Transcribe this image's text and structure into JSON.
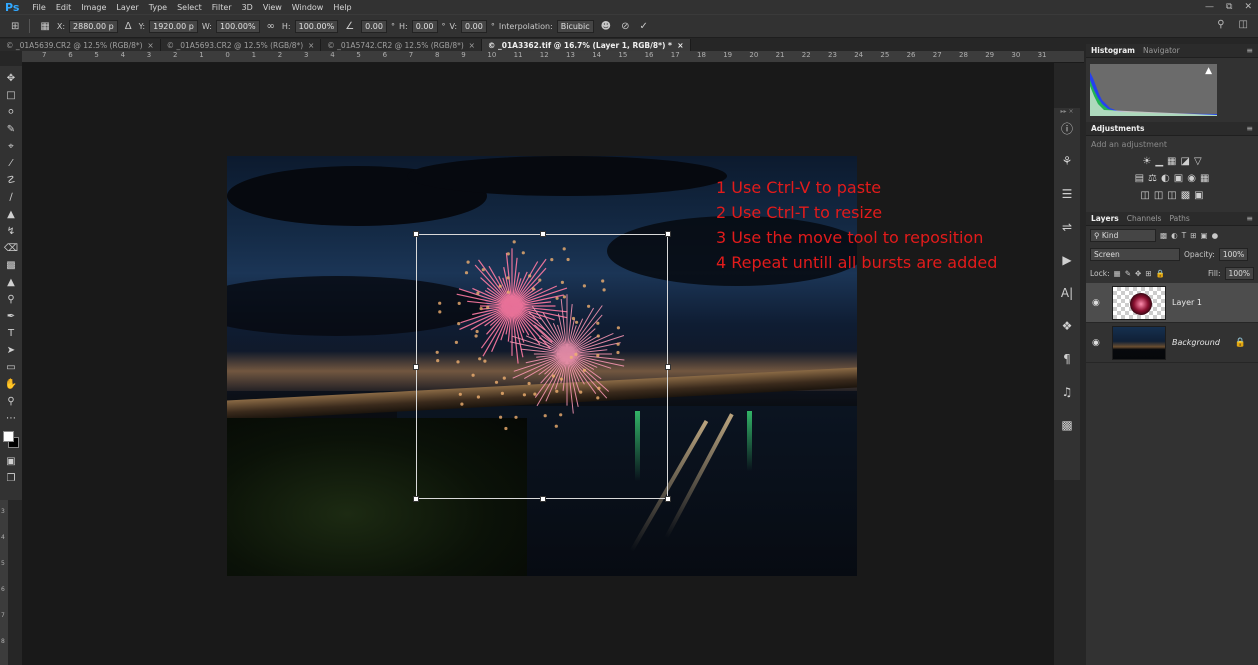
{
  "menubar": {
    "logo": "Ps",
    "items": [
      "File",
      "Edit",
      "Image",
      "Layer",
      "Type",
      "Select",
      "Filter",
      "3D",
      "View",
      "Window",
      "Help"
    ]
  },
  "options": {
    "x_label": "X:",
    "x_value": "2880.00 p",
    "y_label": "Y:",
    "y_value": "1920.00 p",
    "w_label": "W:",
    "w_value": "100.00%",
    "h_label": "H:",
    "h_value": "100.00%",
    "angle_value": "0.00",
    "hskew_label": "H:",
    "hskew_value": "0.00",
    "vskew_label": "V:",
    "vskew_value": "0.00",
    "interp_label": "Interpolation:",
    "interp_value": "Bicubic"
  },
  "tabs": [
    {
      "label": "_01A5639.CR2 @ 12.5% (RGB/8*)",
      "active": false
    },
    {
      "label": "_01A5693.CR2 @ 12.5% (RGB/8*)",
      "active": false
    },
    {
      "label": "_01A5742.CR2 @ 12.5% (RGB/8*)",
      "active": false
    },
    {
      "label": "_01A3362.tif @ 16.7% (Layer 1, RGB/8*) *",
      "active": true
    }
  ],
  "ruler": {
    "h_ticks": [
      "7",
      "6",
      "5",
      "4",
      "3",
      "2",
      "1",
      "0",
      "1",
      "2",
      "3",
      "4",
      "5",
      "6",
      "7",
      "8",
      "9",
      "10",
      "11",
      "12",
      "13",
      "14",
      "15",
      "16",
      "17",
      "18",
      "19",
      "20",
      "21",
      "22",
      "23",
      "24",
      "25",
      "26",
      "27",
      "28",
      "29",
      "30",
      "31"
    ],
    "v_ticks": [
      "3",
      "4",
      "5",
      "6",
      "7",
      "8"
    ]
  },
  "instructions": [
    "1 Use Ctrl-V to paste",
    "2 Use Ctrl-T to resize",
    "3 Use the move tool to reposition",
    "4 Repeat untill all bursts are added"
  ],
  "panels": {
    "histogram_tab": "Histogram",
    "navigator_tab": "Navigator",
    "adjustments_title": "Adjustments",
    "adjustments_hint": "Add an adjustment",
    "layers_tab": "Layers",
    "channels_tab": "Channels",
    "paths_tab": "Paths",
    "kind_label": "Kind",
    "blend_mode": "Screen",
    "opacity_label": "Opacity:",
    "opacity_value": "100%",
    "lock_label": "Lock:",
    "fill_label": "Fill:",
    "fill_value": "100%",
    "layers": [
      {
        "name": "Layer 1",
        "selected": true
      },
      {
        "name": "Background",
        "selected": false,
        "locked": true
      }
    ]
  },
  "colors": {
    "instruction_text": "#e21b1b",
    "ps_logo": "#31a8ff"
  }
}
